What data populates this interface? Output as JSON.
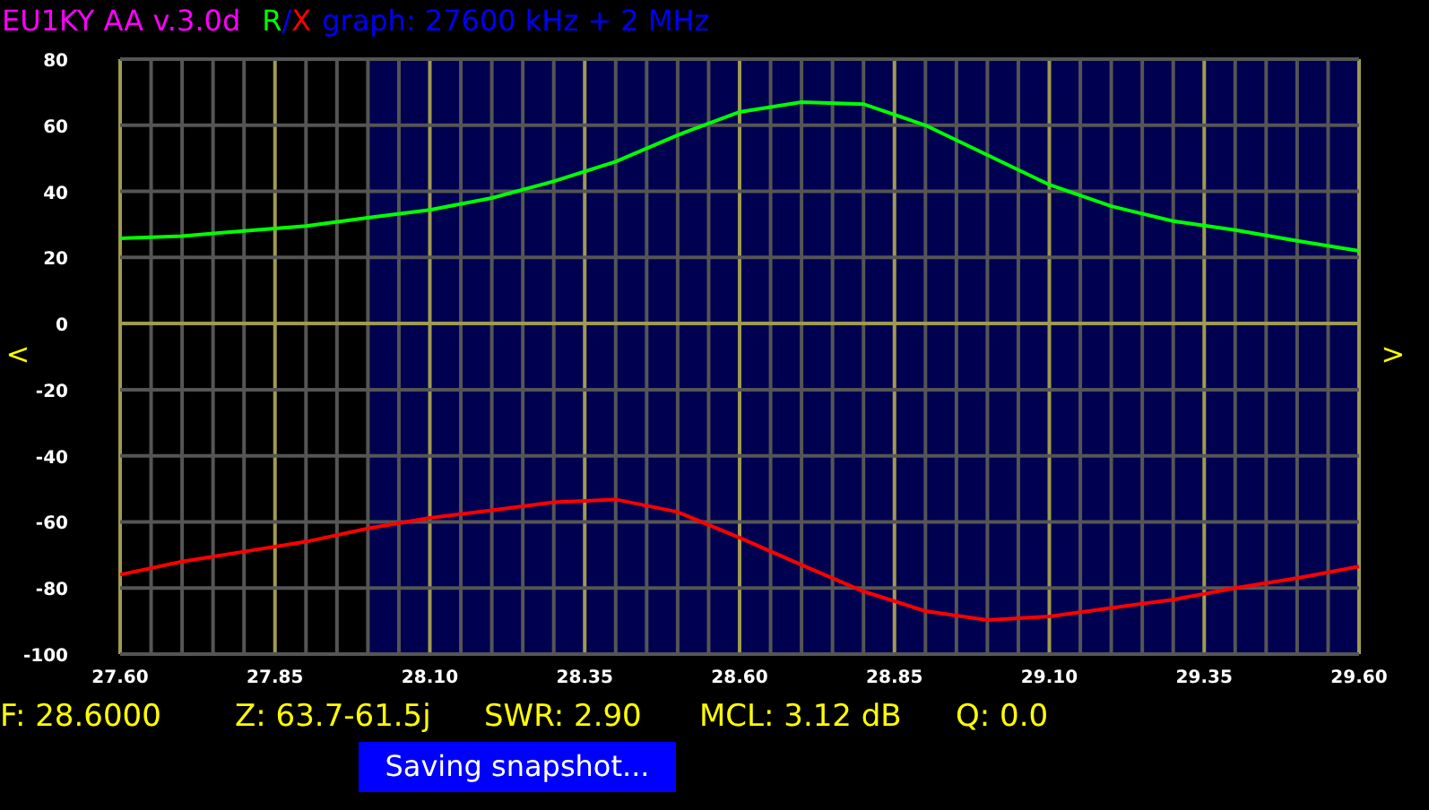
{
  "header": {
    "title": "EU1KY AA v.3.0d",
    "separator": "/",
    "graph_info": "graph: 27600 kHz + 2 MHz"
  },
  "chart": {
    "chart_data": {
      "type": "line",
      "x": [
        27.6,
        27.7,
        27.8,
        27.9,
        28.0,
        28.1,
        28.2,
        28.3,
        28.4,
        28.5,
        28.6,
        28.7,
        28.8,
        28.9,
        29.0,
        29.1,
        29.2,
        29.3,
        29.4,
        29.5,
        29.6
      ],
      "series": [
        {
          "name": "R",
          "color": "#00ff00",
          "values": [
            25.8,
            26.5,
            28,
            29.5,
            32,
            34.4,
            38,
            43,
            49,
            57,
            64,
            67,
            66.4,
            60,
            51,
            42,
            35.5,
            31,
            28.3,
            25,
            22
          ]
        },
        {
          "name": "X",
          "color": "#ff0000",
          "values": [
            -76,
            -72,
            -69,
            -66,
            -62,
            -58.8,
            -56.5,
            -54,
            -53.2,
            -57,
            -64.8,
            -73,
            -81,
            -87,
            -89.7,
            -88.6,
            -86,
            -83.5,
            -80,
            -77,
            -73.5
          ]
        }
      ],
      "xlim": [
        27.6,
        29.6
      ],
      "ylim": [
        -100,
        80
      ],
      "xticks": [
        {
          "value": 27.6,
          "label": "27.60"
        },
        {
          "value": 27.85,
          "label": "27.85"
        },
        {
          "value": 28.1,
          "label": "28.10"
        },
        {
          "value": 28.35,
          "label": "28.35"
        },
        {
          "value": 28.6,
          "label": "28.60"
        },
        {
          "value": 28.85,
          "label": "28.85"
        },
        {
          "value": 29.1,
          "label": "29.10"
        },
        {
          "value": 29.35,
          "label": "29.35"
        },
        {
          "value": 29.6,
          "label": "29.60"
        }
      ],
      "yticks": [
        80,
        60,
        40,
        20,
        0,
        -20,
        -40,
        -60,
        -80,
        -100
      ],
      "grid": true,
      "bands": [
        {
          "axis": "x",
          "from": 28.0,
          "to": 29.6,
          "color": "#000050"
        }
      ]
    },
    "prev_button": "<",
    "next_button": ">"
  },
  "status": {
    "frequency": "F: 28.6000",
    "impedance": "Z: 63.7-61.5j",
    "swr": "SWR: 2.90",
    "mcl": "MCL: 3.12 dB",
    "q": "Q: 0.0"
  },
  "toast": "Saving snapshot..."
}
